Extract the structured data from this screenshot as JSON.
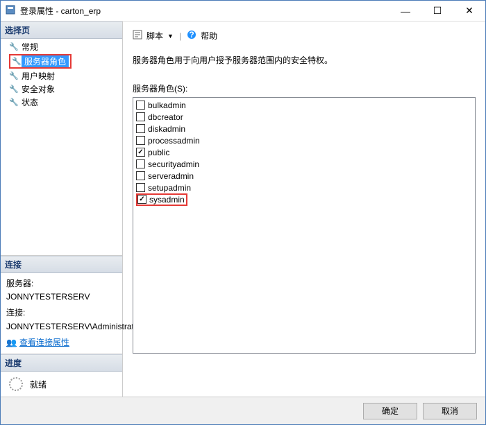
{
  "window": {
    "title": "登录属性 - carton_erp"
  },
  "sidebar": {
    "select_page_header": "选择页",
    "items": [
      {
        "label": "常规"
      },
      {
        "label": "服务器角色"
      },
      {
        "label": "用户映射"
      },
      {
        "label": "安全对象"
      },
      {
        "label": "状态"
      }
    ],
    "connection_header": "连接",
    "connection": {
      "server_label": "服务器:",
      "server_value": "JONNYTESTERSERV",
      "conn_label": "连接:",
      "conn_value": "JONNYTESTERSERV\\Administrat",
      "view_props": "查看连接属性"
    },
    "progress_header": "进度",
    "progress_status": "就绪"
  },
  "main": {
    "toolbar": {
      "script": "脚本",
      "help": "帮助"
    },
    "description": "服务器角色用于向用户授予服务器范围内的安全特权。",
    "list_label": "服务器角色(S):",
    "roles": [
      {
        "name": "bulkadmin",
        "checked": false
      },
      {
        "name": "dbcreator",
        "checked": false
      },
      {
        "name": "diskadmin",
        "checked": false
      },
      {
        "name": "processadmin",
        "checked": false
      },
      {
        "name": "public",
        "checked": true
      },
      {
        "name": "securityadmin",
        "checked": false
      },
      {
        "name": "serveradmin",
        "checked": false
      },
      {
        "name": "setupadmin",
        "checked": false
      },
      {
        "name": "sysadmin",
        "checked": true
      }
    ]
  },
  "footer": {
    "ok": "确定",
    "cancel": "取消"
  }
}
